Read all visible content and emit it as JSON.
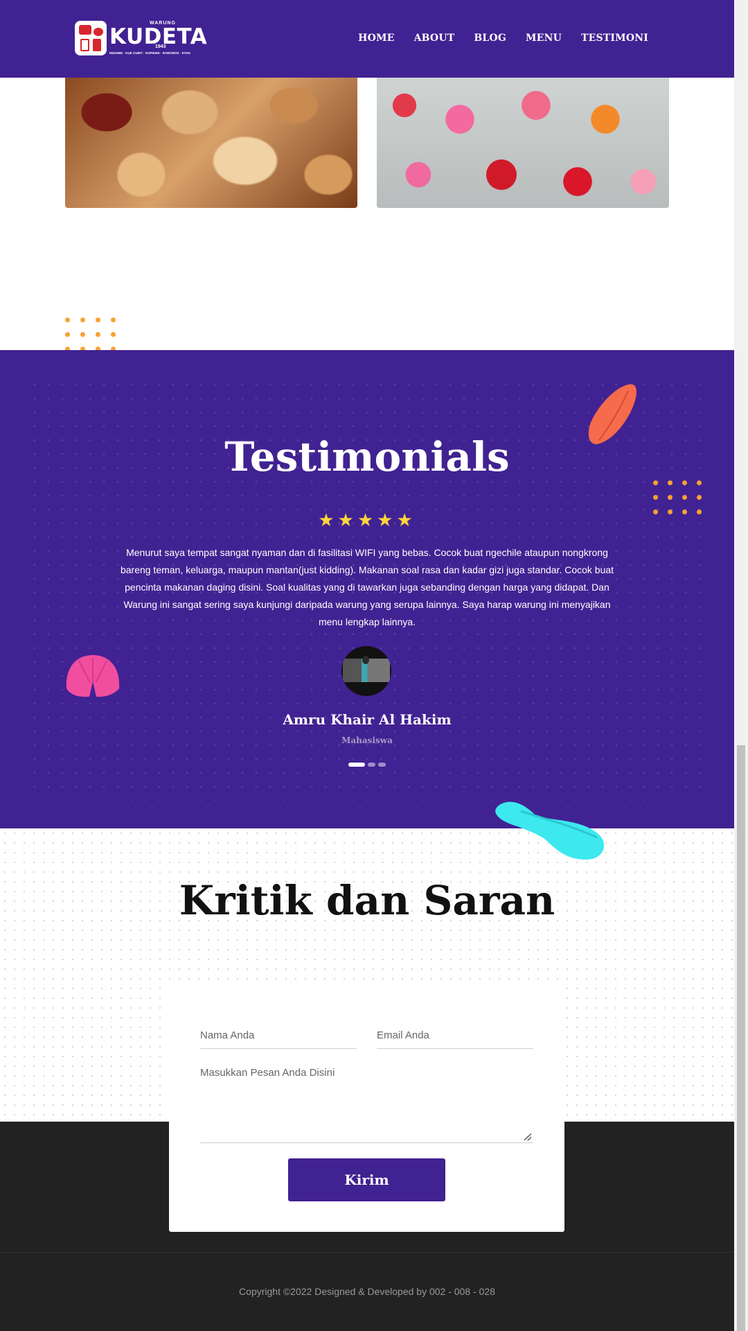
{
  "header": {
    "logo": {
      "top_text": "WARUNG",
      "name": "KUDETA",
      "year": "1943",
      "subtitle": "INDOMIE · KUE CUBIT · KOPIKMS · RAWOROK · ETAN"
    },
    "nav": [
      {
        "label": "HOME"
      },
      {
        "label": "ABOUT"
      },
      {
        "label": "BLOG"
      },
      {
        "label": "MENU"
      },
      {
        "label": "TESTIMONI"
      }
    ]
  },
  "testimonials": {
    "title": "Testimonials",
    "stars": "★★★★★",
    "rating": 5,
    "text": "Menurut saya tempat sangat nyaman dan di fasilitasi WIFI yang bebas. Cocok buat ngechile ataupun nongkrong bareng teman, keluarga, maupun mantan(just kidding). Makanan soal rasa dan kadar gizi juga standar. Cocok buat pencinta makanan daging disini. Soal kualitas yang di tawarkan juga sebanding dengan harga yang didapat. Dan Warung ini sangat sering saya kunjungi daripada warung yang serupa lainnya. Saya harap warung ini menyajikan menu lengkap lainnya.",
    "name": "Amru Khair Al Hakim",
    "role": "Mahasiswa",
    "slides": 3,
    "active_slide": 1
  },
  "feedback": {
    "title": "Kritik dan Saran",
    "name_placeholder": "Nama Anda",
    "email_placeholder": "Email Anda",
    "message_placeholder": "Masukkan Pesan Anda Disini",
    "submit_label": "Kirim"
  },
  "footer": {
    "copyright": "Copyright ©2022 Designed & Developed by 002 - 008 - 028"
  },
  "colors": {
    "primary": "#412292",
    "accent_orange": "#f7a234",
    "star": "#ffd43b",
    "footer_bg": "#222222"
  }
}
